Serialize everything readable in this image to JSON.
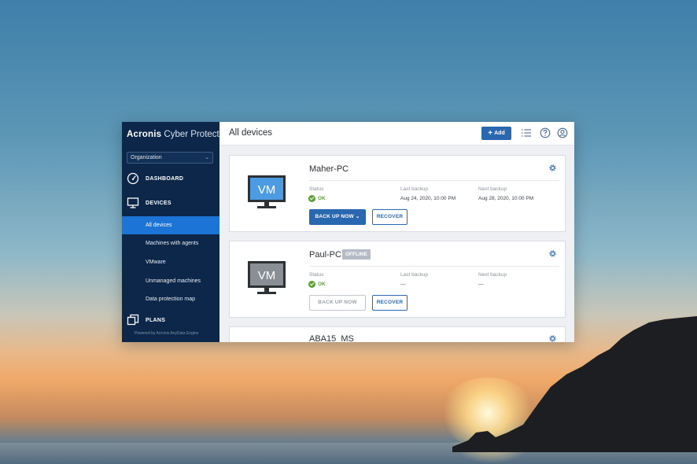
{
  "brand": {
    "name_bold": "Acronis",
    "name_light": "Cyber Protect"
  },
  "organization": {
    "selected": "Organization"
  },
  "nav": {
    "dashboard": "DASHBOARD",
    "devices": "DEVICES",
    "sub_items": [
      "All devices",
      "Machines with agents",
      "VMware",
      "Unmanaged machines",
      "Data protection map"
    ],
    "active_sub": "All devices",
    "plans": "PLANS"
  },
  "footer": {
    "powered_by": "Powered by Acronis AnyData Engine"
  },
  "header": {
    "title": "All devices",
    "add_label": "Add"
  },
  "labels": {
    "status": "Status",
    "last_backup": "Last backup",
    "next_backup": "Next backup"
  },
  "devices": [
    {
      "name": "Maher-PC",
      "icon_text": "VM",
      "badge": "",
      "status": "OK",
      "last_backup": "Aug 24, 2020, 10:00 PM",
      "next_backup": "Aug 28, 2020, 10:00 PM",
      "backup_button": "BACK UP NOW",
      "recover_button": "RECOVER"
    },
    {
      "name": "Paul-PC",
      "icon_text": "VM",
      "badge": "OFFLINE",
      "status": "OK",
      "last_backup": "—",
      "next_backup": "—",
      "backup_button": "BACK UP NOW",
      "recover_button": "RECOVER"
    },
    {
      "name": "ABA15_MS"
    }
  ],
  "colors": {
    "sidebar_bg": "#0c2749",
    "accent": "#2a67b1",
    "active_nav": "#1d74d7",
    "status_ok": "#5aa233",
    "offline_badge": "#b6bcc5"
  }
}
